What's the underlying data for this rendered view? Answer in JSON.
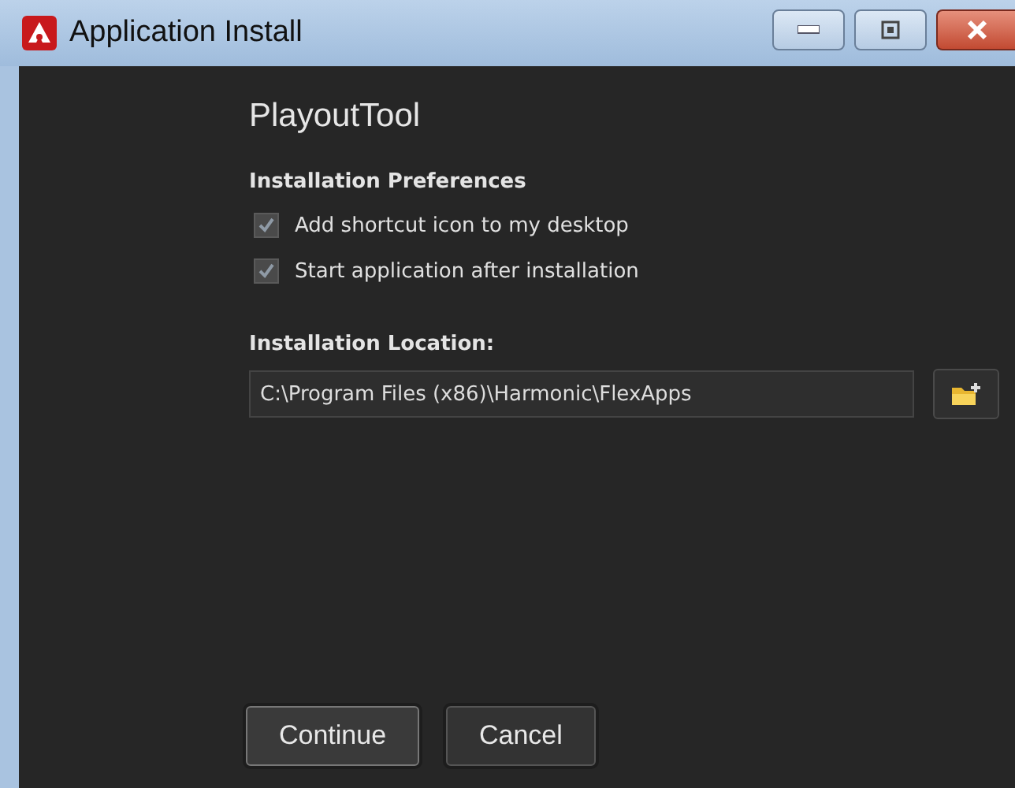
{
  "window": {
    "title": "Application Install"
  },
  "app_name": "PlayoutTool",
  "preferences": {
    "heading": "Installation Preferences",
    "options": [
      {
        "label": "Add shortcut icon to my desktop",
        "checked": true
      },
      {
        "label": "Start application after installation",
        "checked": true
      }
    ]
  },
  "location": {
    "label": "Installation Location:",
    "value": "C:\\Program Files (x86)\\Harmonic\\FlexApps"
  },
  "buttons": [
    {
      "label": "Continue",
      "focused": true
    },
    {
      "label": "Cancel",
      "focused": false
    }
  ]
}
